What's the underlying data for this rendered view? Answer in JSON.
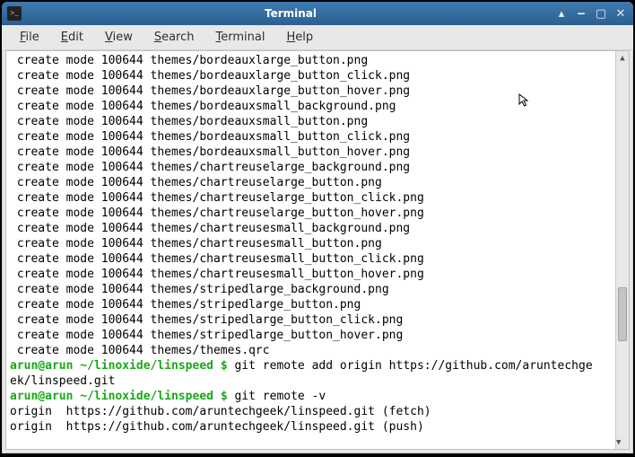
{
  "window": {
    "title": "Terminal",
    "icon_glyph": ">_"
  },
  "menubar": {
    "file": "File",
    "edit": "Edit",
    "view": "View",
    "search": "Search",
    "terminal": "Terminal",
    "help": "Help"
  },
  "terminal": {
    "create_prefix": " create mode 100644 ",
    "files": [
      "themes/bordeauxlarge_button.png",
      "themes/bordeauxlarge_button_click.png",
      "themes/bordeauxlarge_button_hover.png",
      "themes/bordeauxsmall_background.png",
      "themes/bordeauxsmall_button.png",
      "themes/bordeauxsmall_button_click.png",
      "themes/bordeauxsmall_button_hover.png",
      "themes/chartreuselarge_background.png",
      "themes/chartreuselarge_button.png",
      "themes/chartreuselarge_button_click.png",
      "themes/chartreuselarge_button_hover.png",
      "themes/chartreusesmall_background.png",
      "themes/chartreusesmall_button.png",
      "themes/chartreusesmall_button_click.png",
      "themes/chartreusesmall_button_hover.png",
      "themes/stripedlarge_background.png",
      "themes/stripedlarge_button.png",
      "themes/stripedlarge_button_click.png",
      "themes/stripedlarge_button_hover.png",
      "themes/themes.qrc"
    ],
    "prompt_user": "arun@arun",
    "prompt_path": "~/linoxide/linspeed",
    "prompt_symbol": "$",
    "cmd1": "git remote add origin https://github.com/aruntechge",
    "cmd1_cont": "ek/linspeed.git",
    "cmd2": "git remote -v",
    "out_fetch": "origin  https://github.com/aruntechgeek/linspeed.git (fetch)",
    "out_push": "origin  https://github.com/aruntechgeek/linspeed.git (push)"
  }
}
